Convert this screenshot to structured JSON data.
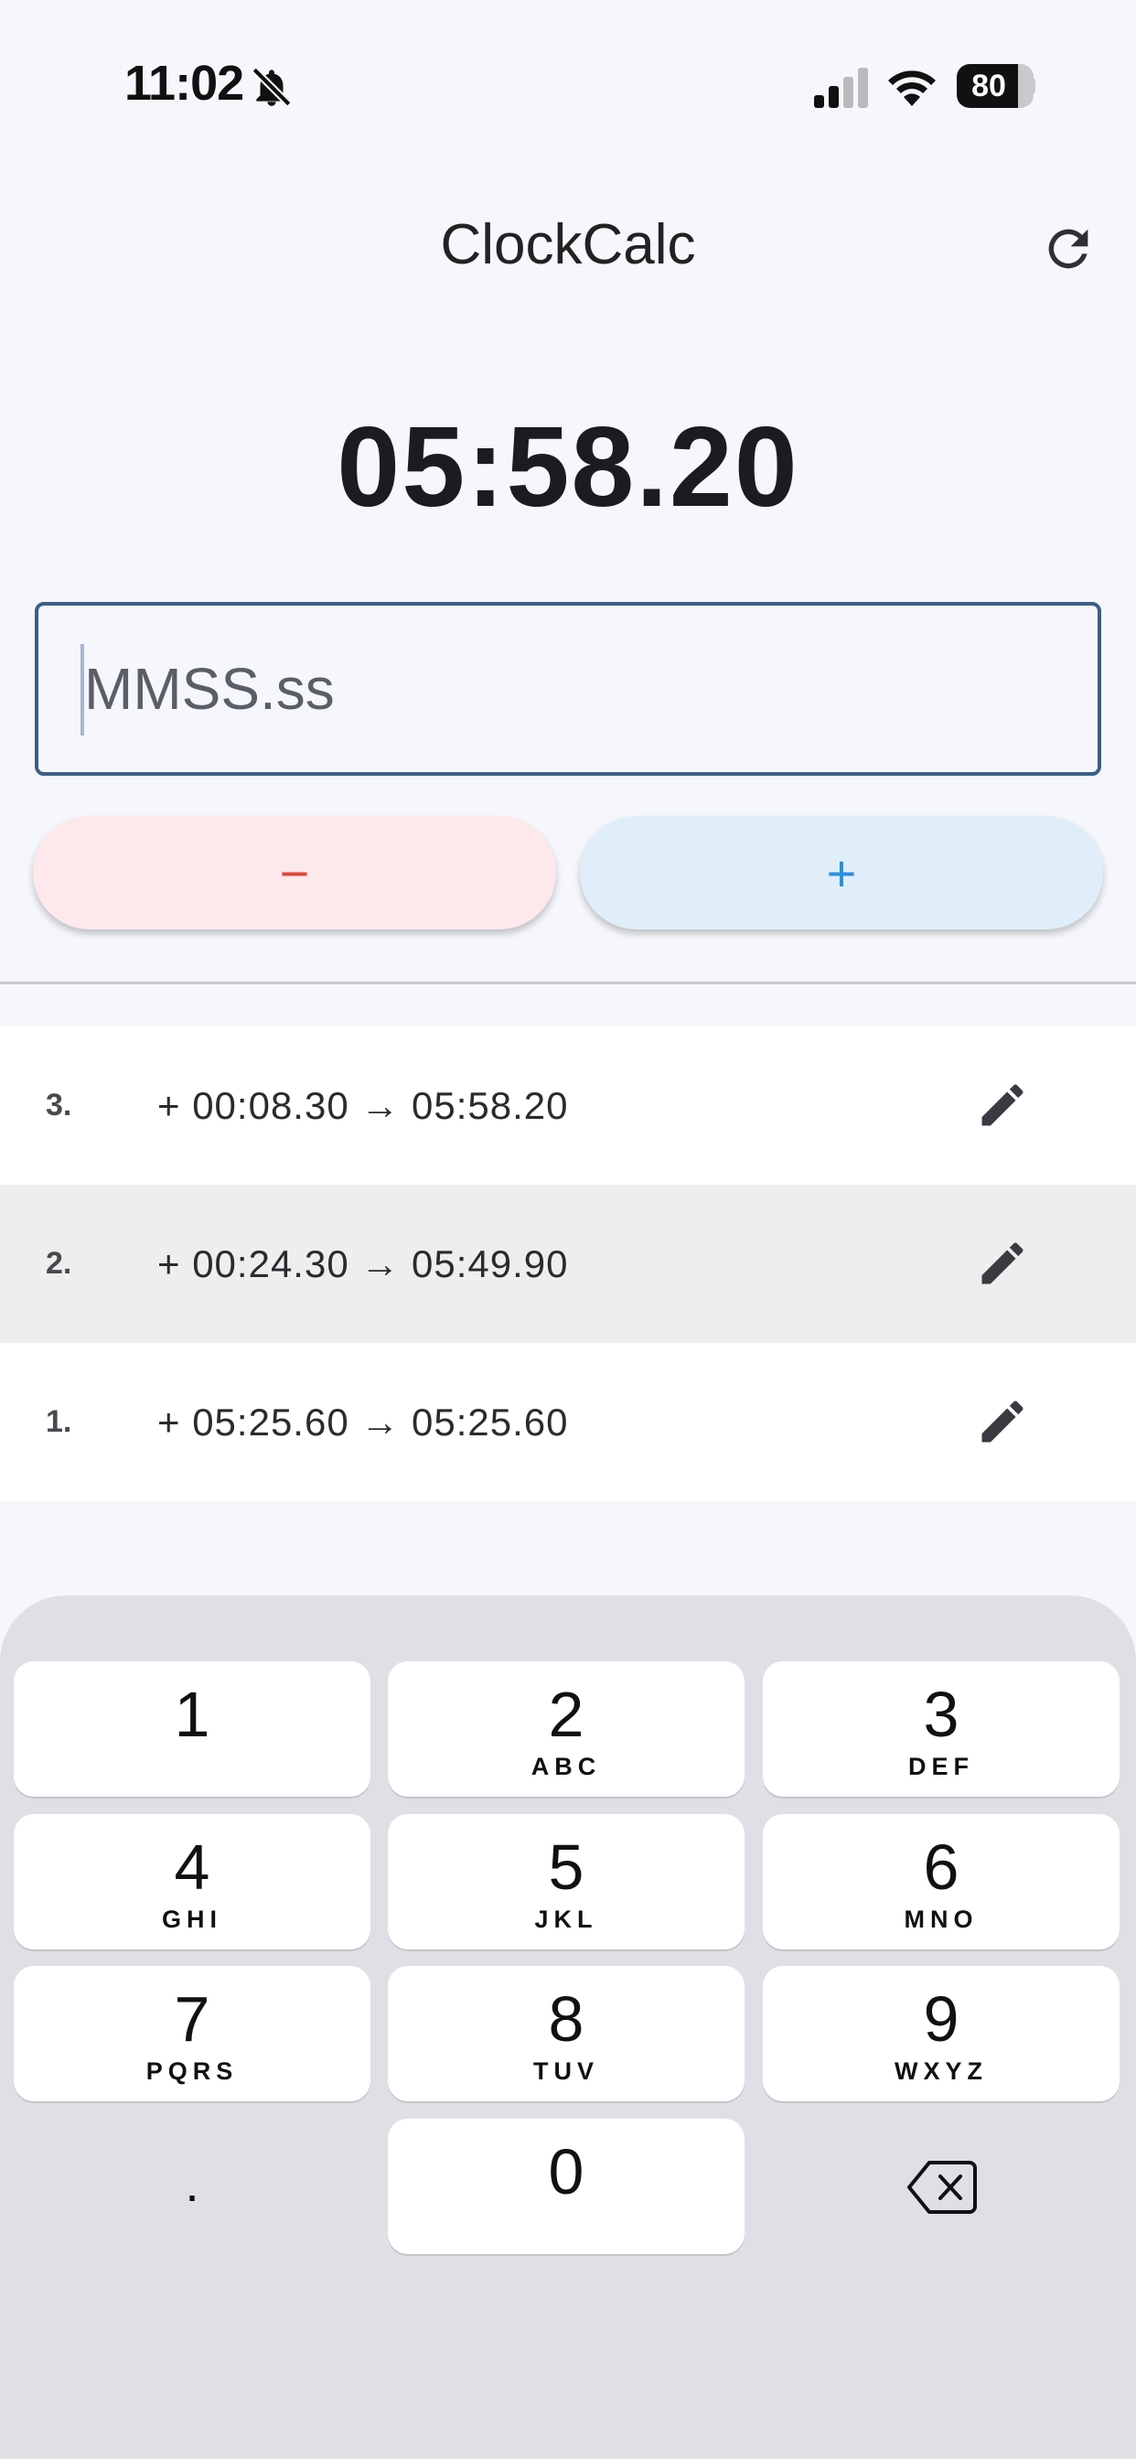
{
  "status_bar": {
    "time": "11:02",
    "silent_icon": "bell-slash-icon",
    "signal_icon": "cellular-signal-icon",
    "wifi_icon": "wifi-icon",
    "battery_level": 80,
    "battery_label": "80"
  },
  "app_bar": {
    "title": "ClockCalc",
    "refresh_icon": "refresh-icon"
  },
  "total": "05:58.20",
  "input": {
    "placeholder": "MMSS.ss",
    "value": ""
  },
  "buttons": {
    "subtract_label": "−",
    "add_label": "+"
  },
  "history": [
    {
      "index": "3.",
      "expression": "+ 00:08.30 → 05:58.20",
      "edit_icon": "pencil-icon"
    },
    {
      "index": "2.",
      "expression": "+ 00:24.30 → 05:49.90",
      "edit_icon": "pencil-icon"
    },
    {
      "index": "1.",
      "expression": "+ 05:25.60 → 05:25.60",
      "edit_icon": "pencil-icon"
    }
  ],
  "keypad": {
    "keys": [
      {
        "num": "1",
        "letters": ""
      },
      {
        "num": "2",
        "letters": "ABC"
      },
      {
        "num": "3",
        "letters": "DEF"
      },
      {
        "num": "4",
        "letters": "GHI"
      },
      {
        "num": "5",
        "letters": "JKL"
      },
      {
        "num": "6",
        "letters": "MNO"
      },
      {
        "num": "7",
        "letters": "PQRS"
      },
      {
        "num": "8",
        "letters": "TUV"
      },
      {
        "num": "9",
        "letters": "WXYZ"
      },
      {
        "num": "0",
        "letters": ""
      }
    ],
    "decimal_label": ".",
    "delete_icon": "backspace-icon"
  },
  "colors": {
    "background": "#f5f7fc",
    "input_border": "#3c5f86",
    "minus_bg": "#fde8ec",
    "minus_fg": "#e0473a",
    "plus_bg": "#e0eef9",
    "plus_fg": "#2a8fde",
    "keypad_bg": "#dfe0e5"
  }
}
